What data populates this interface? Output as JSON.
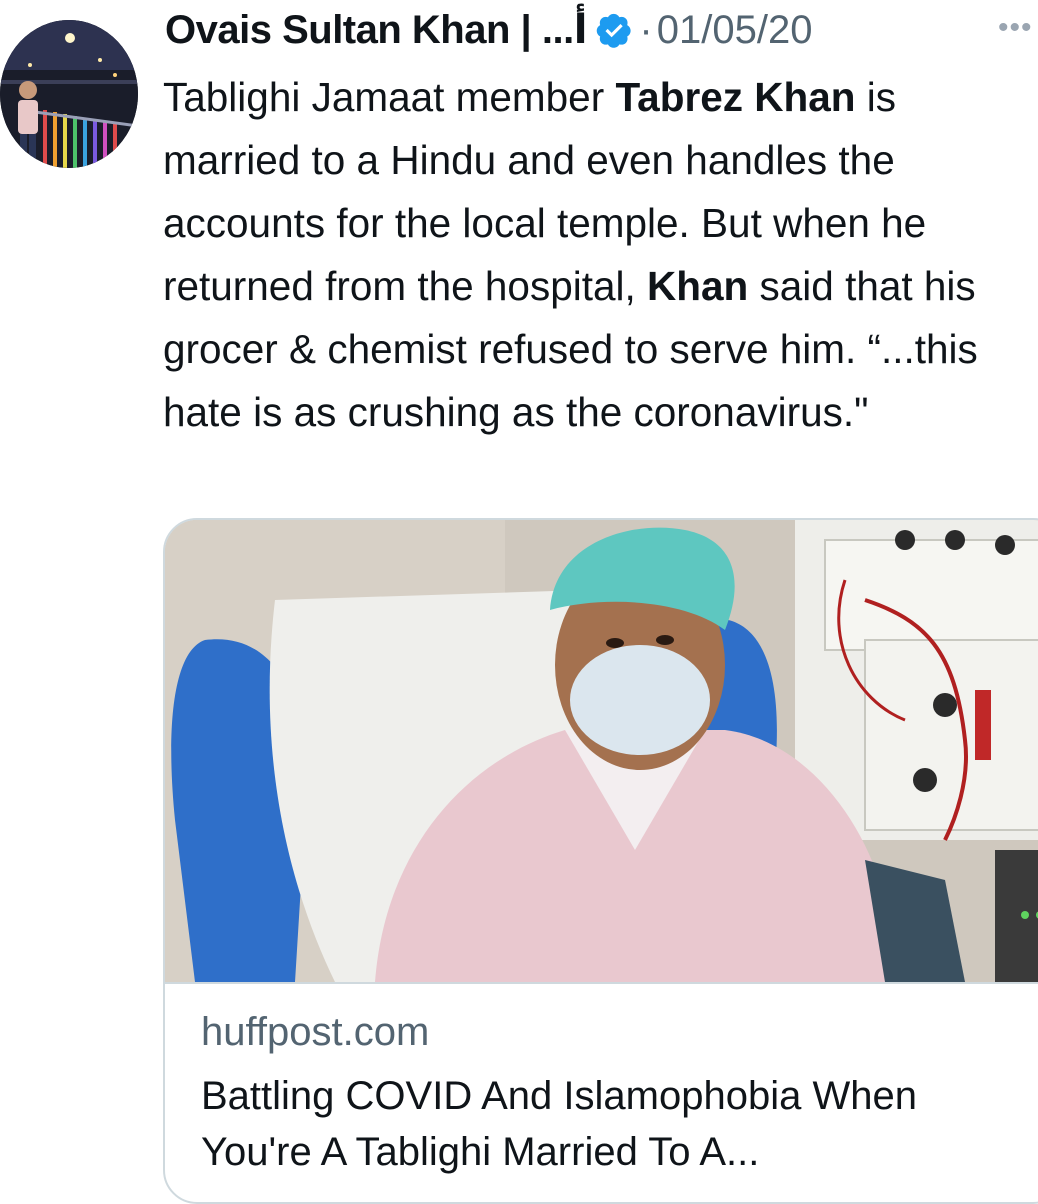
{
  "tweet": {
    "author": {
      "display_name": "Ovais Sultan Khan | ...أ",
      "verified": true,
      "avatar_icon": "profile-photo"
    },
    "separator": "·",
    "timestamp": "01/05/20",
    "more_icon": "more-options-icon",
    "text_segments": [
      {
        "text": "Tablighi Jamaat member ",
        "bold": false
      },
      {
        "text": "Tabrez Khan",
        "bold": true
      },
      {
        "text": " is married to a Hindu and even handles the accounts for the local temple. But when he returned from the hospital, ",
        "bold": false
      },
      {
        "text": "Khan",
        "bold": true
      },
      {
        "text": " said that his grocer & chemist refused to serve him. “...this hate is as crushing as the coronavirus.\"",
        "bold": false
      }
    ]
  },
  "link_card": {
    "domain": "huffpost.com",
    "title": "Battling COVID And Islamophobia When You're A Tablighi Married To A...",
    "image_icon": "article-photo"
  },
  "colors": {
    "text_primary": "#0f1419",
    "text_secondary": "#536471",
    "verified_blue": "#1d9bf0",
    "card_border": "#cfd9de"
  }
}
